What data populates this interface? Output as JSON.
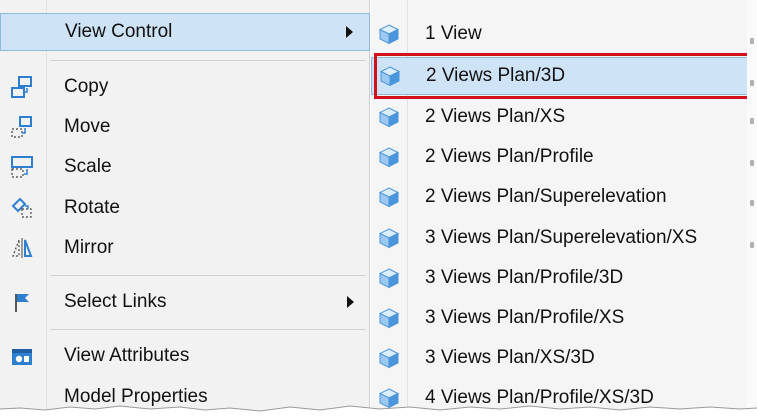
{
  "left_menu": {
    "items": [
      {
        "label": "View Control",
        "icon": "none",
        "has_submenu": true,
        "highlighted": true
      },
      {
        "label": "Copy",
        "icon": "copy-icon",
        "has_submenu": false
      },
      {
        "label": "Move",
        "icon": "move-icon",
        "has_submenu": false
      },
      {
        "label": "Scale",
        "icon": "scale-icon",
        "has_submenu": false
      },
      {
        "label": "Rotate",
        "icon": "rotate-icon",
        "has_submenu": false
      },
      {
        "label": "Mirror",
        "icon": "mirror-icon",
        "has_submenu": false
      },
      {
        "label": "Select Links",
        "icon": "select-links-icon",
        "has_submenu": true
      },
      {
        "label": "View Attributes",
        "icon": "view-attributes-icon",
        "has_submenu": false
      },
      {
        "label": "Model Properties",
        "icon": "none",
        "has_submenu": false
      }
    ]
  },
  "submenu": {
    "items": [
      {
        "label": "1 View"
      },
      {
        "label": "2 Views Plan/3D",
        "selected": true
      },
      {
        "label": "2 Views Plan/XS"
      },
      {
        "label": "2 Views Plan/Profile"
      },
      {
        "label": "2 Views Plan/Superelevation"
      },
      {
        "label": "3 Views Plan/Superelevation/XS"
      },
      {
        "label": "3 Views Plan/Profile/3D"
      },
      {
        "label": "3 Views Plan/Profile/XS"
      },
      {
        "label": "3 Views Plan/XS/3D"
      },
      {
        "label": "4 Views Plan/Profile/XS/3D"
      }
    ]
  },
  "colors": {
    "highlight": "#cfe3f6",
    "highlight_border": "#8fb8e0",
    "callout_outline": "#d0121b",
    "icon_blue": "#2f7fd0",
    "cube_light": "#dbeeff",
    "cube_mid": "#9cc9f1",
    "cube_dark": "#4a95dc"
  }
}
